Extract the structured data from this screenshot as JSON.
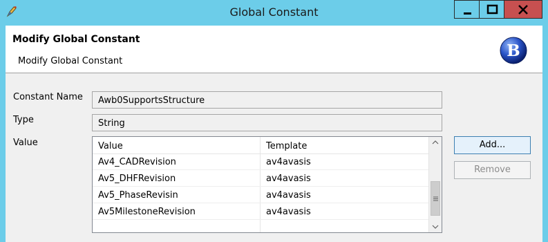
{
  "window": {
    "title": "Global Constant",
    "controls": [
      "minimize",
      "maximize",
      "close"
    ],
    "app_icon": "pen-icon"
  },
  "header": {
    "title": "Modify Global Constant",
    "description": "Modify Global Constant",
    "logo_letter": "B"
  },
  "form": {
    "constant_name_label": "Constant Name",
    "constant_name_value": "Awb0SupportsStructure",
    "type_label": "Type",
    "type_value": "String",
    "value_label": "Value"
  },
  "table": {
    "columns": [
      "Value",
      "Template"
    ],
    "rows": [
      {
        "value": "Av4_CADRevision",
        "template": "av4avasis"
      },
      {
        "value": "Av5_DHFRevision",
        "template": "av4avasis"
      },
      {
        "value": "Av5_PhaseRevisin",
        "template": "av4avasis"
      },
      {
        "value": "Av5MilestoneRevision",
        "template": "av4avasis"
      }
    ]
  },
  "buttons": {
    "add": "Add...",
    "remove": "Remove"
  },
  "colors": {
    "titlebar": "#6ccde9",
    "close_button": "#c75050",
    "dialog_background": "#f0f0f0",
    "add_button_border": "#3c7fb1"
  }
}
